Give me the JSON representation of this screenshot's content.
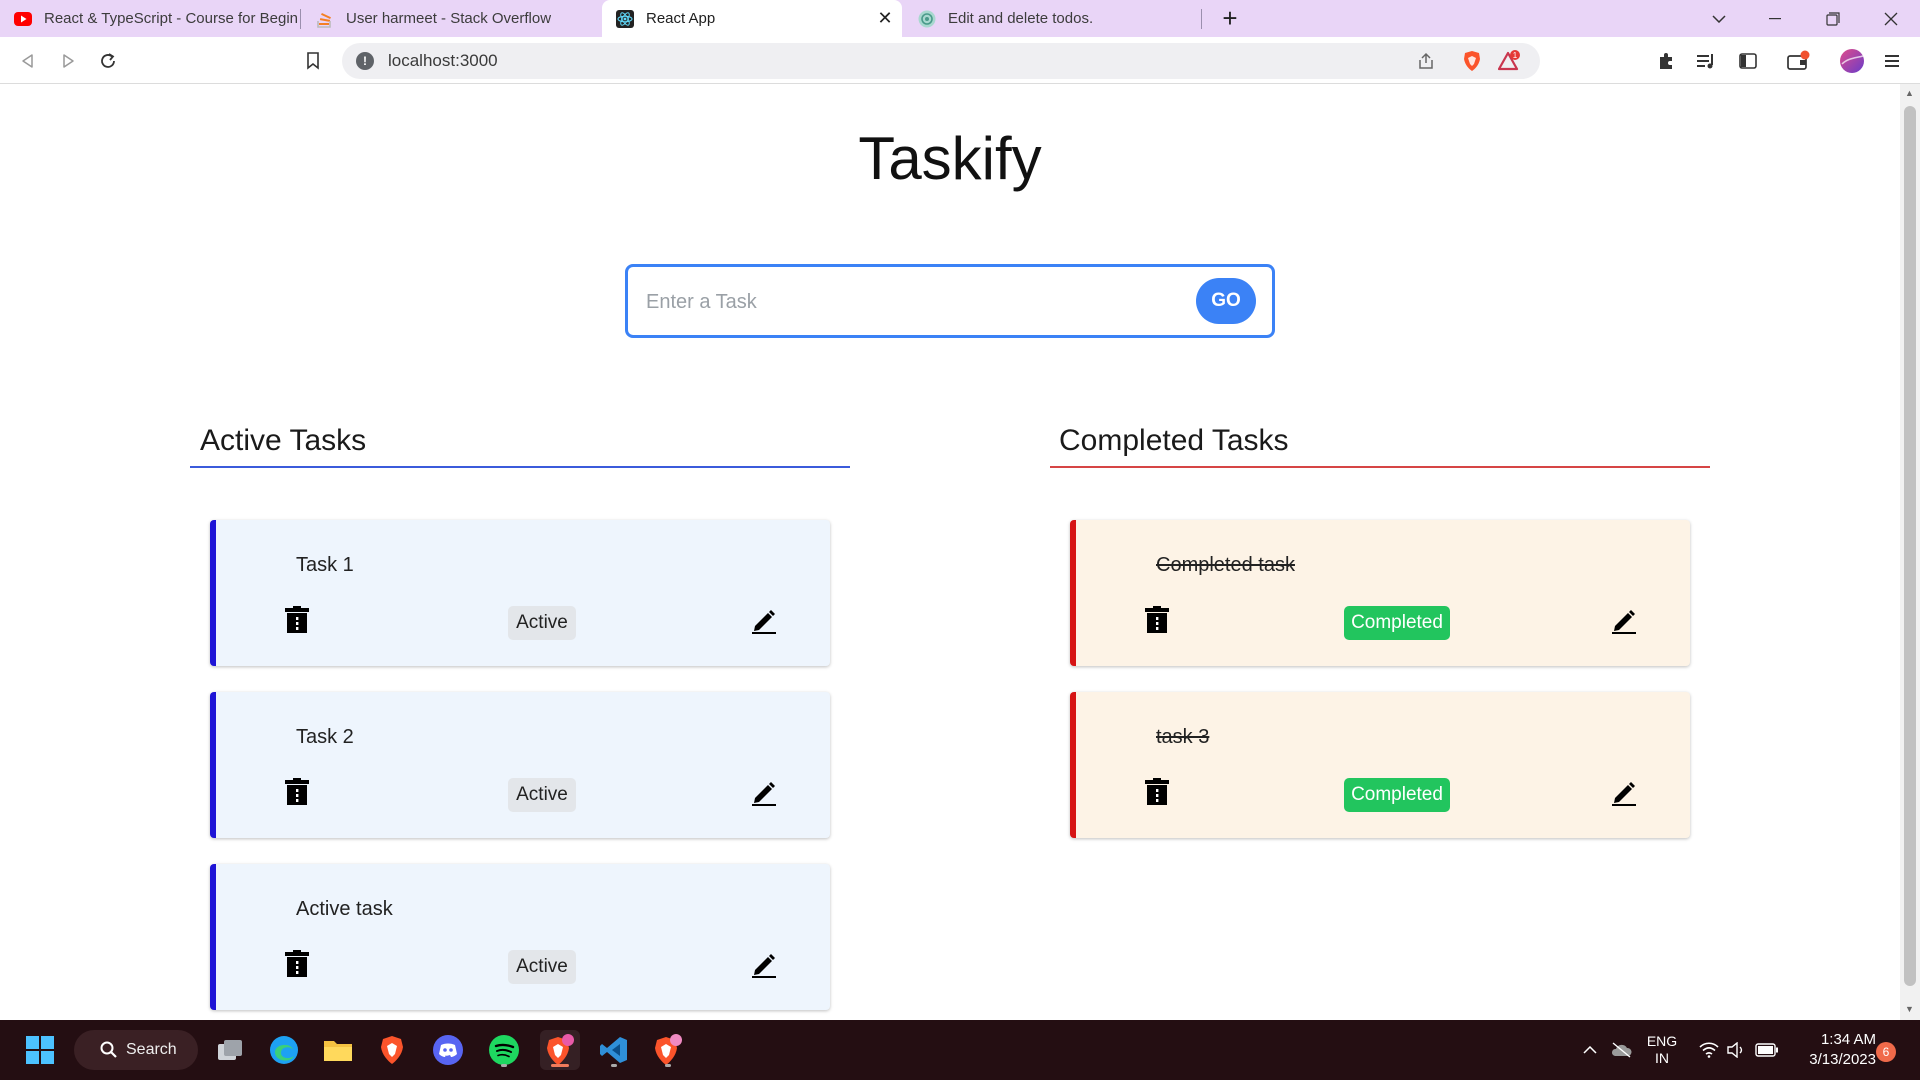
{
  "browser": {
    "tabs": [
      {
        "title": "React & TypeScript - Course for Begin",
        "icon": "youtube-icon"
      },
      {
        "title": "User harmeet - Stack Overflow",
        "icon": "stackoverflow-icon"
      },
      {
        "title": "React App",
        "icon": "react-icon"
      },
      {
        "title": "Edit and delete todos.",
        "icon": "chatgpt-icon"
      }
    ],
    "url": "localhost:3000",
    "brave_badge": "1",
    "colors": {
      "tabbar": "#e9d5f7",
      "accent": "#3b82f6"
    }
  },
  "app": {
    "title": "Taskify",
    "input_placeholder": "Enter a Task",
    "input_value": "",
    "go_label": "GO",
    "active_heading": "Active Tasks",
    "completed_heading": "Completed Tasks",
    "active_tasks": [
      {
        "text": "Task 1",
        "status": "Active"
      },
      {
        "text": "Task 2",
        "status": "Active"
      },
      {
        "text": "Active task",
        "status": "Active"
      }
    ],
    "completed_tasks": [
      {
        "text": "Completed task",
        "status": "Completed"
      },
      {
        "text": "task 3",
        "status": "Completed"
      }
    ],
    "colors": {
      "active_border": "#1e14d6",
      "active_bg": "#eef5fd",
      "completed_border": "#d61414",
      "completed_bg": "#fdf3e6",
      "completed_badge": "#22c55e",
      "active_line": "#3b5bdb",
      "completed_line": "#d64545"
    }
  },
  "taskbar": {
    "search_label": "Search",
    "lang_line1": "ENG",
    "lang_line2": "IN",
    "time": "1:34 AM",
    "date": "3/13/2023",
    "notification_count": "6"
  }
}
